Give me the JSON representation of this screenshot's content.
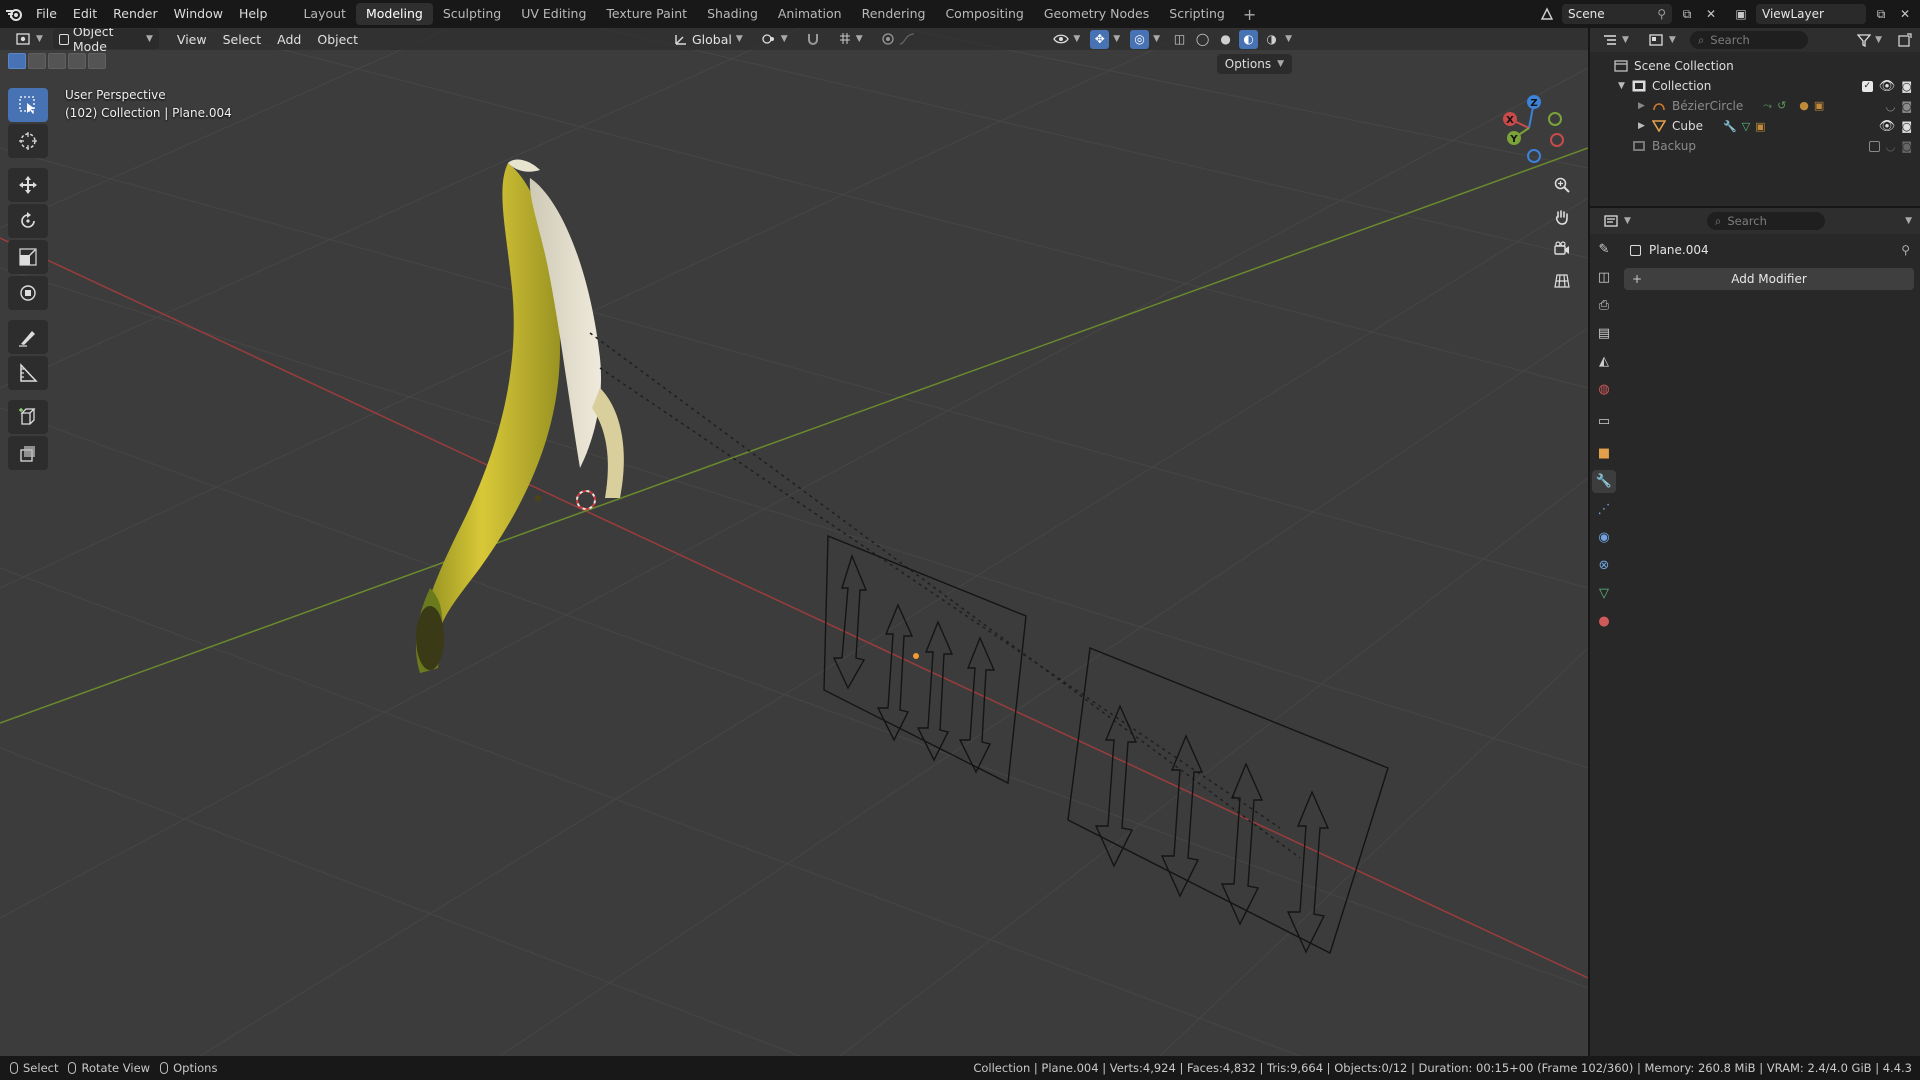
{
  "topbar": {
    "menus": [
      "File",
      "Edit",
      "Render",
      "Window",
      "Help"
    ],
    "workspaces": [
      "Layout",
      "Modeling",
      "Sculpting",
      "UV Editing",
      "Texture Paint",
      "Shading",
      "Animation",
      "Rendering",
      "Compositing",
      "Geometry Nodes",
      "Scripting"
    ],
    "active_workspace": "Modeling",
    "scene_name": "Scene",
    "view_layer_name": "ViewLayer"
  },
  "viewport_header": {
    "mode": "Object Mode",
    "menus": [
      "View",
      "Select",
      "Add",
      "Object"
    ],
    "transform_orientation": "Global",
    "options_label": "Options"
  },
  "viewport_overlay": {
    "view_name": "User Perspective",
    "context": "(102) Collection | Plane.004"
  },
  "gizmo": {
    "x_label": "X",
    "y_label": "Y",
    "z_label": "Z"
  },
  "outliner": {
    "search_placeholder": "Search",
    "scene_collection": "Scene Collection",
    "collection": "Collection",
    "items": [
      {
        "name": "BézierCircle",
        "dimmed": true
      },
      {
        "name": "Cube",
        "dimmed": false
      }
    ],
    "backup": "Backup"
  },
  "properties": {
    "search_placeholder": "Search",
    "object_name": "Plane.004",
    "add_modifier_label": "Add Modifier"
  },
  "statusbar": {
    "select_label": "Select",
    "rotate_label": "Rotate View",
    "options_label": "Options",
    "stats": "Collection | Plane.004 | Verts:4,924 | Faces:4,832 | Tris:9,664 | Objects:0/12 | Duration: 00:15+00 (Frame 102/360) | Memory: 260.8 MiB | VRAM: 2.4/4.0 GiB | 4.4.3"
  },
  "colors": {
    "accent": "#4772b3",
    "x_axis": "#c84a4a",
    "y_axis": "#7aa33a",
    "z_axis": "#3b82d8",
    "banana_yellow": "#d8c838"
  }
}
